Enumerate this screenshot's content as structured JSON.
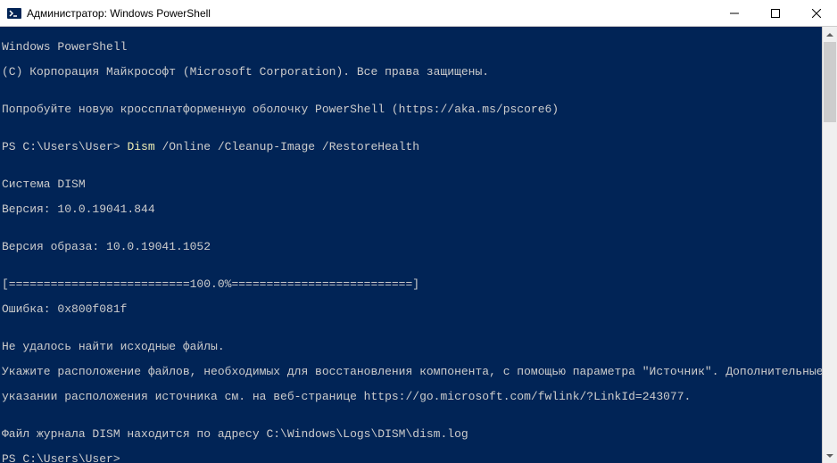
{
  "window": {
    "title": "Администратор: Windows PowerShell"
  },
  "terminal": {
    "line1": "Windows PowerShell",
    "line2": "(С) Корпорация Майкрософт (Microsoft Corporation). Все права защищены.",
    "blank": "",
    "line3": "Попробуйте новую кроссплатформенную оболочку PowerShell (https://aka.ms/pscore6)",
    "prompt1_prefix": "PS C:\\Users\\User> ",
    "prompt1_cmd": "Dism",
    "prompt1_args": " /Online /Cleanup-Image /RestoreHealth",
    "line5": "Cистема DISM",
    "line6": "Версия: 10.0.19041.844",
    "line7": "Версия образа: 10.0.19041.1052",
    "line8": "[==========================100.0%==========================]",
    "line9": "Ошибка: 0x800f081f",
    "line10": "Не удалось найти исходные файлы.",
    "line11": "Укажите расположение файлов, необходимых для восстановления компонента, с помощью параметра \"Источник\". Дополнительные сведения об",
    "line12": "указании расположения источника см. на веб-странице https://go.microsoft.com/fwlink/?LinkId=243077.",
    "line13": "Файл журнала DISM находится по адресу C:\\Windows\\Logs\\DISM\\dism.log",
    "prompt2": "PS C:\\Users\\User>"
  }
}
